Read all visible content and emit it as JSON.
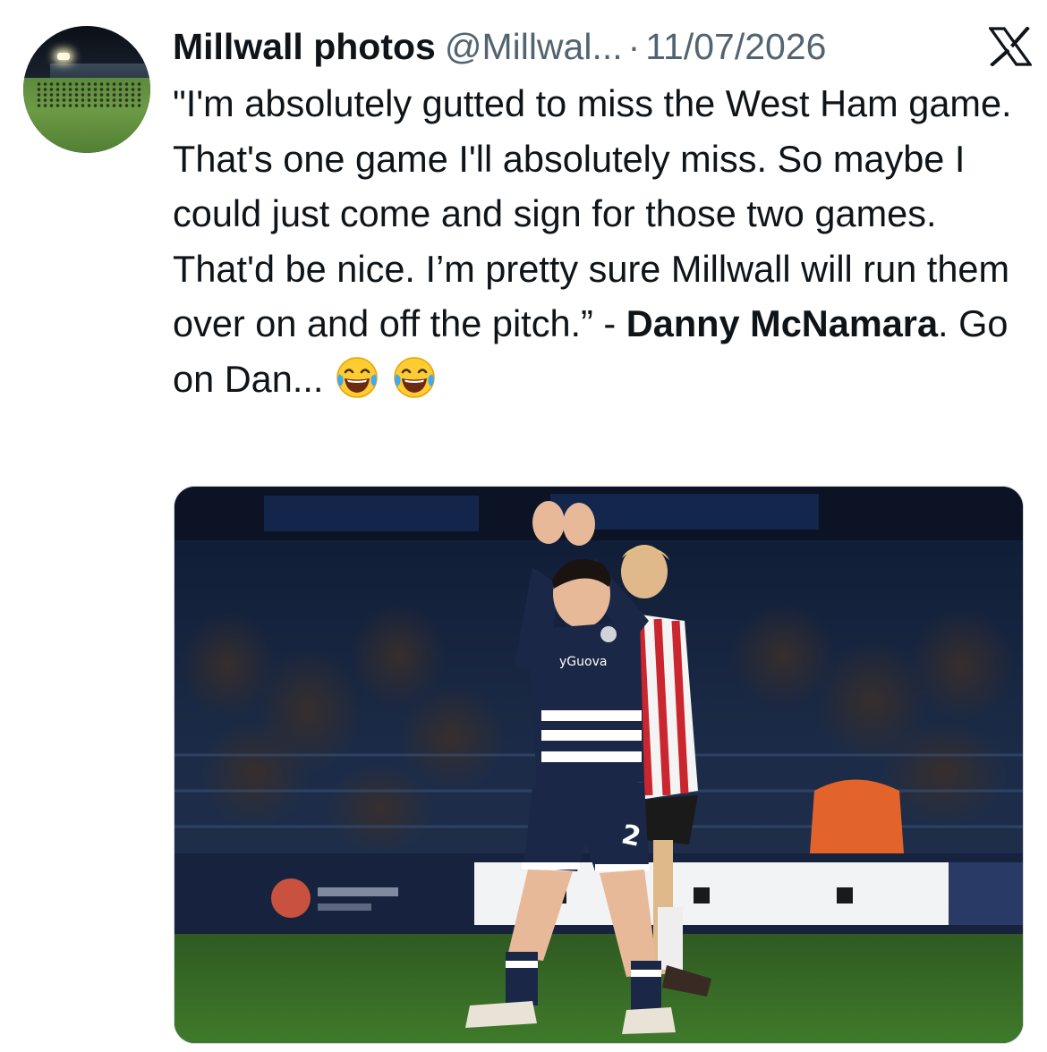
{
  "tweet": {
    "author_name": "Millwall photos",
    "handle": "@Millwal...",
    "separator": "·",
    "date": "11/07/2026",
    "text_before_bold": "\"I'm absolutely gutted to miss the West Ham game. That's one game I'll absolutely miss. So maybe I could just come and sign for those two games. That'd be nice. I’m pretty sure Millwall will run them over on and off the pitch.” - ",
    "text_bold": "Danny McNamara",
    "text_after_bold": ". Go on Dan...",
    "emojis": [
      "face-with-tears-of-joy",
      "face-with-tears-of-joy"
    ]
  },
  "platform_logo": "x-logo",
  "media": {
    "alt_icon": "photo",
    "shirt_sponsor": "yGuova",
    "shirt_number": "2"
  },
  "colors": {
    "primary_text": "#0f1419",
    "secondary_text": "#536471",
    "millwall_navy": "#1b2747",
    "border": "#cfd9de"
  }
}
